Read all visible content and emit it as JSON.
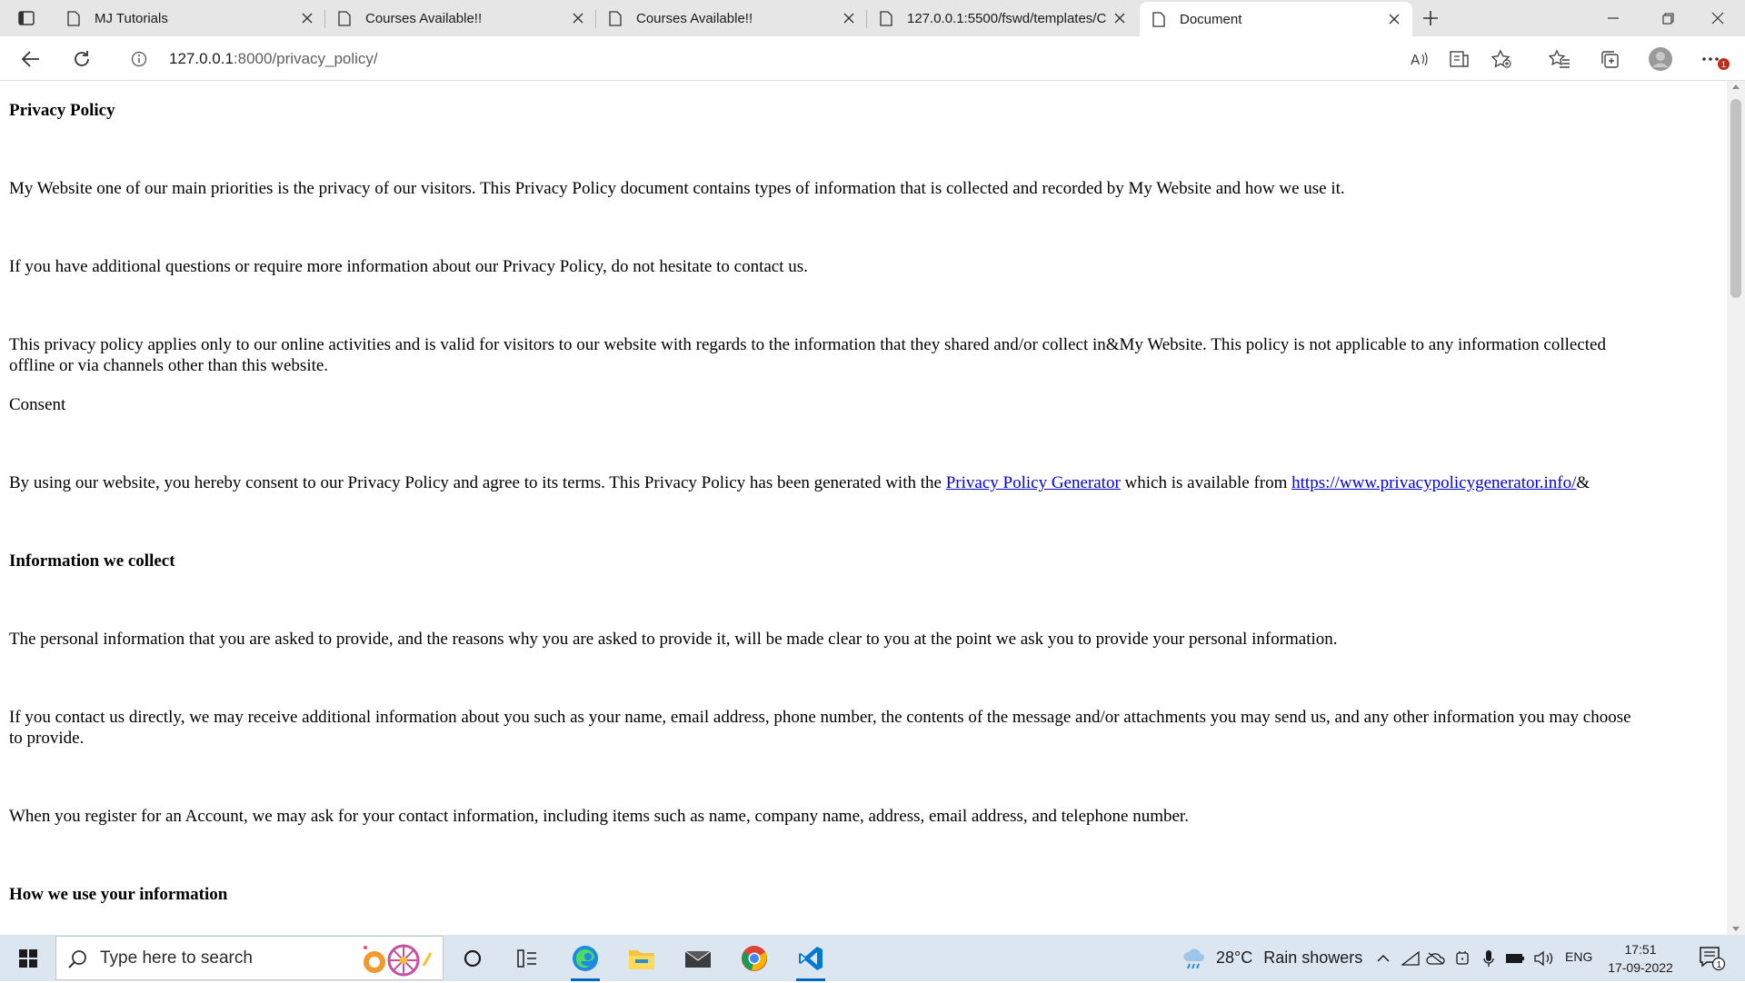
{
  "browser": {
    "tabs": [
      {
        "title": "MJ Tutorials",
        "active": false
      },
      {
        "title": "Courses Available!!",
        "active": false
      },
      {
        "title": "Courses Available!!",
        "active": false
      },
      {
        "title": "127.0.0.1:5500/fswd/templates/C",
        "active": false
      },
      {
        "title": "Document",
        "active": true
      }
    ],
    "address": {
      "host": "127.0.0.1",
      "rest": ":8000/privacy_policy/"
    },
    "notification_count": "1"
  },
  "page": {
    "heading": "Privacy Policy",
    "p1": "My Website one of our main priorities is the privacy of our visitors. This Privacy Policy document contains types of information that is collected and recorded by My Website and how we use it.",
    "p2": "If you have additional questions or require more information about our Privacy Policy, do not hesitate to contact us.",
    "p3_line1": "This privacy policy applies only to our online activities and is valid for visitors to our website with regards to the information that they shared and/or collect in&My Website. This policy is not applicable to any information collected",
    "p3_line2": "offline or via channels other than this website.",
    "consent_label": "Consent",
    "p4_before": "By using our website, you hereby consent to our Privacy Policy and agree to its terms. This Privacy Policy has been generated with the ",
    "p4_link1": "Privacy Policy Generator",
    "p4_middle": " which is available from ",
    "p4_link2": "https://www.privacypolicygenerator.info/",
    "p4_after": "&",
    "heading2": "Information we collect",
    "p5": "The personal information that you are asked to provide, and the reasons why you are asked to provide it, will be made clear to you at the point we ask you to provide your personal information.",
    "p6_line1": "If you contact us directly, we may receive additional information about you such as your name, email address, phone number, the contents of the message and/or attachments you may send us, and any other information you may choose",
    "p6_line2": "to provide.",
    "p7": "When you register for an Account, we may ask for your contact information, including items such as name, company name, address, email address, and telephone number.",
    "heading3": "How we use your information"
  },
  "taskbar": {
    "search_placeholder": "Type here to search",
    "weather_temp": "28°C",
    "weather_text": "Rain showers",
    "language": "ENG",
    "time": "17:51",
    "date": "17-09-2022",
    "notification_count": "1"
  },
  "colors": {
    "link": "#0000ee",
    "taskbar": "#dce6f0",
    "tabstrip": "#e6e6e6",
    "accent": "#0067c0"
  }
}
